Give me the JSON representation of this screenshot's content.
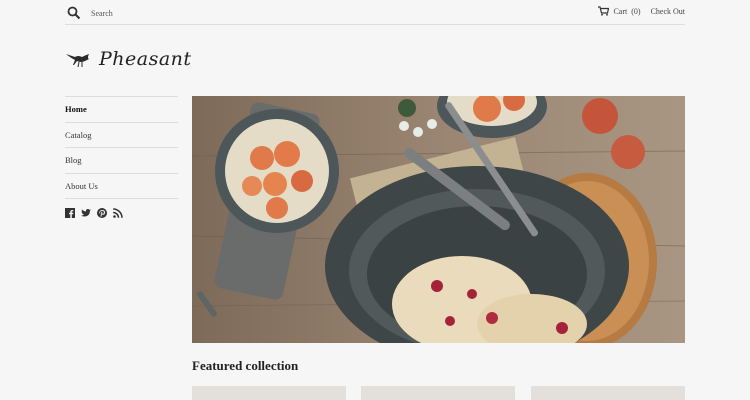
{
  "header": {
    "search_label": "Search",
    "cart_label": "Cart",
    "cart_count": "(0)",
    "checkout_label": "Check Out"
  },
  "brand": {
    "name": "Pheasant"
  },
  "nav": {
    "items": [
      {
        "label": "Home",
        "active": true
      },
      {
        "label": "Catalog"
      },
      {
        "label": "Blog"
      },
      {
        "label": "About Us"
      }
    ]
  },
  "social": {
    "icons": [
      "facebook-icon",
      "twitter-icon",
      "pinterest-icon",
      "rss-icon"
    ]
  },
  "main": {
    "featured_title": "Featured collection"
  },
  "colors": {
    "background": "#f6f6f6",
    "text": "#333333",
    "divider": "#dcdcdc"
  }
}
